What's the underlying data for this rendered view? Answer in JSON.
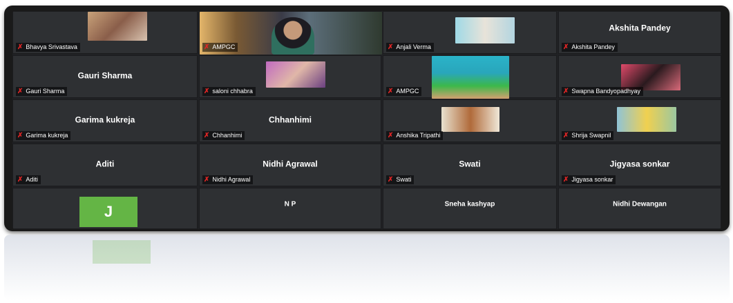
{
  "meeting": {
    "tiles": [
      {
        "id": "bhavya",
        "label": "Bhavya Srivastava",
        "center": ""
      },
      {
        "id": "ampgc1",
        "label": "AMPGC",
        "center": ""
      },
      {
        "id": "anjali",
        "label": "Anjali Verma",
        "center": ""
      },
      {
        "id": "akshita",
        "label": "Akshita Pandey",
        "center": "Akshita Pandey"
      },
      {
        "id": "gauri",
        "label": "Gauri Sharma",
        "center": "Gauri Sharma"
      },
      {
        "id": "saloni",
        "label": "saloni chhabra",
        "center": ""
      },
      {
        "id": "ampgc2",
        "label": "AMPGC",
        "center": ""
      },
      {
        "id": "swapna",
        "label": "Swapna Bandyopadhyay",
        "center": ""
      },
      {
        "id": "garima",
        "label": "Garima kukreja",
        "center": "Garima kukreja"
      },
      {
        "id": "chhanhimi",
        "label": "Chhanhimi",
        "center": "Chhanhimi"
      },
      {
        "id": "anshika",
        "label": "Anshika Tripathi",
        "center": ""
      },
      {
        "id": "shrija",
        "label": "Shrija Swapnil",
        "center": ""
      },
      {
        "id": "aditi",
        "label": "Aditi",
        "center": "Aditi"
      },
      {
        "id": "nidhi-a",
        "label": "Nidhi Agrawal",
        "center": "Nidhi Agrawal"
      },
      {
        "id": "swati",
        "label": "Swati",
        "center": "Swati"
      },
      {
        "id": "jigyasa",
        "label": "Jigyasa sonkar",
        "center": "Jigyasa sonkar"
      },
      {
        "id": "j",
        "label": "",
        "center": "",
        "avatar": "J"
      },
      {
        "id": "np",
        "label": "",
        "center": "N P"
      },
      {
        "id": "sneha",
        "label": "",
        "center": "Sneha kashyap"
      },
      {
        "id": "nidhi-d",
        "label": "",
        "center": "Nidhi Dewangan"
      }
    ],
    "mic_muted_icon": "mic-muted-icon",
    "colors": {
      "muted_red": "#e02525",
      "avatar_green": "#64b545",
      "tile_bg": "#2e3033"
    }
  }
}
